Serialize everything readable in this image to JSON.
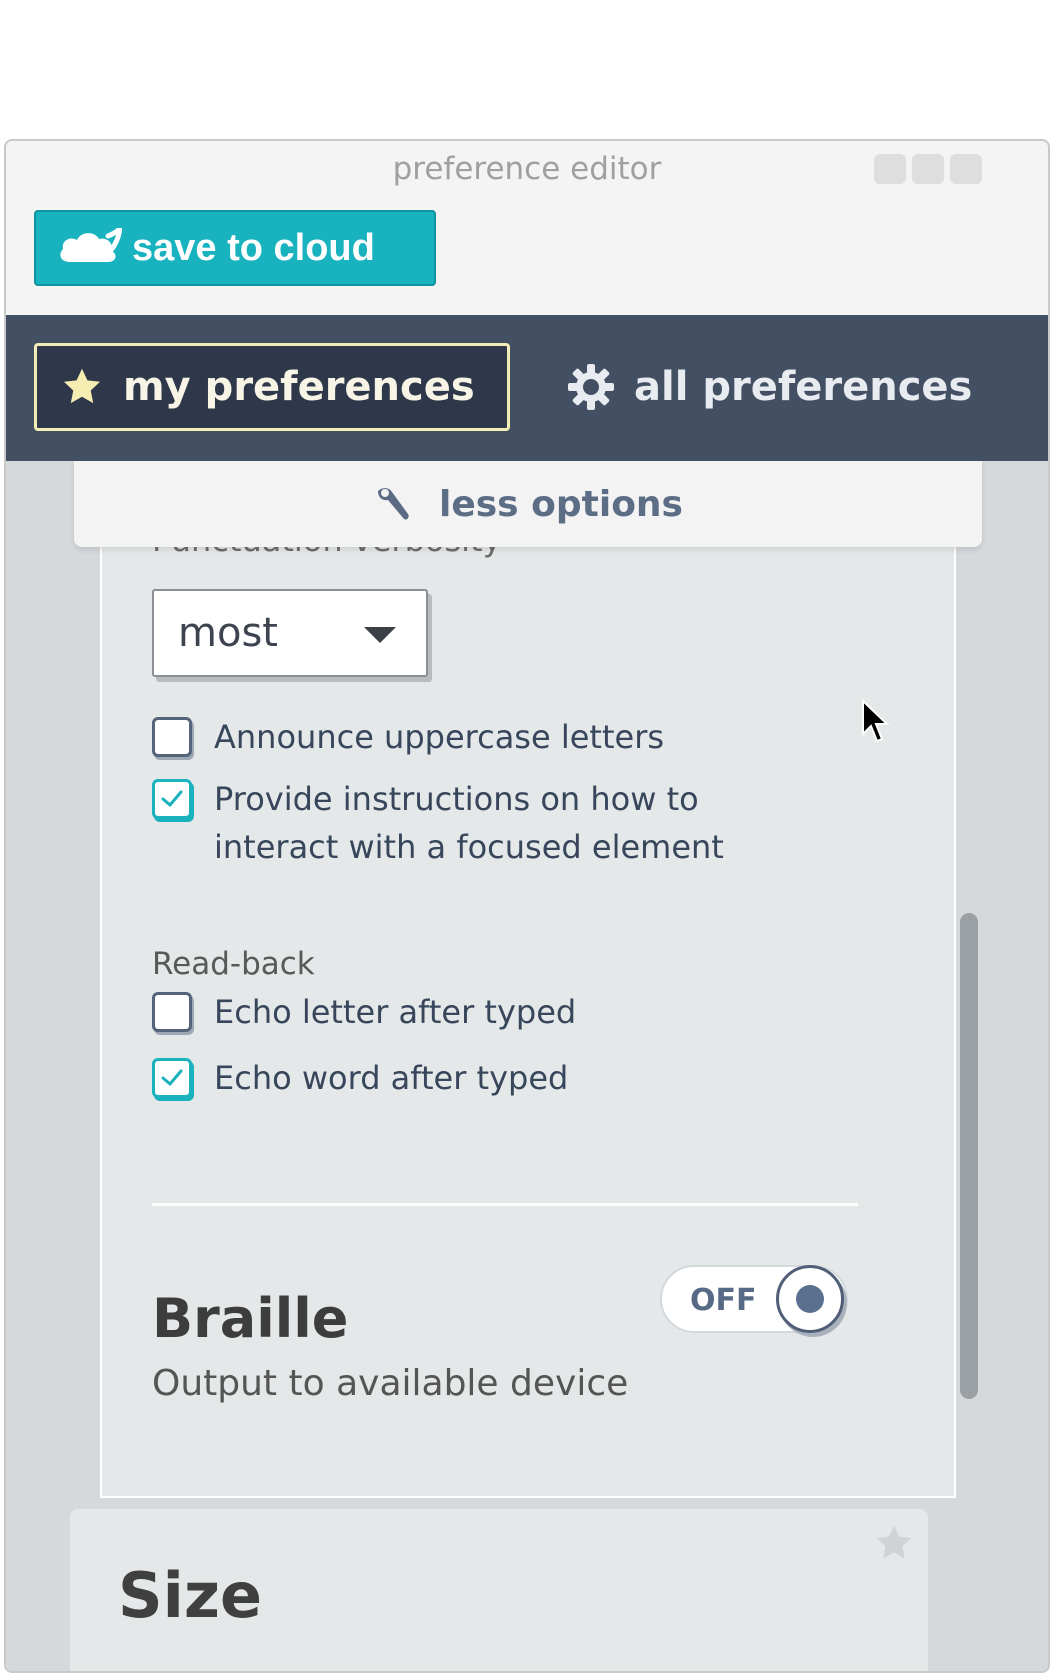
{
  "window": {
    "title": "preference editor"
  },
  "toolbar": {
    "save_label": "save to cloud"
  },
  "tabs": [
    {
      "label": "my preferences",
      "icon": "star-icon",
      "active": true
    },
    {
      "label": "all preferences",
      "icon": "gear-icon",
      "active": false
    }
  ],
  "options_toggle": {
    "label": "less options",
    "icon": "wrench-icon"
  },
  "speech": {
    "punctuation_label": "Punctuation verbosity",
    "punctuation_value": "most",
    "checkboxes": [
      {
        "label": "Announce uppercase letters",
        "checked": false
      },
      {
        "label": "Provide instructions on how to interact with a focused element",
        "checked": true
      }
    ],
    "readback_label": "Read-back",
    "readback": [
      {
        "label": "Echo letter after typed",
        "checked": false
      },
      {
        "label": "Echo word after typed",
        "checked": true
      }
    ]
  },
  "braille": {
    "title": "Braille",
    "description": "Output to available device",
    "toggle_label": "OFF",
    "enabled": false
  },
  "size": {
    "title": "Size"
  },
  "colors": {
    "accent": "#19b3c0",
    "nav_background": "#435064",
    "active_tab_border": "#f3ecb6"
  }
}
